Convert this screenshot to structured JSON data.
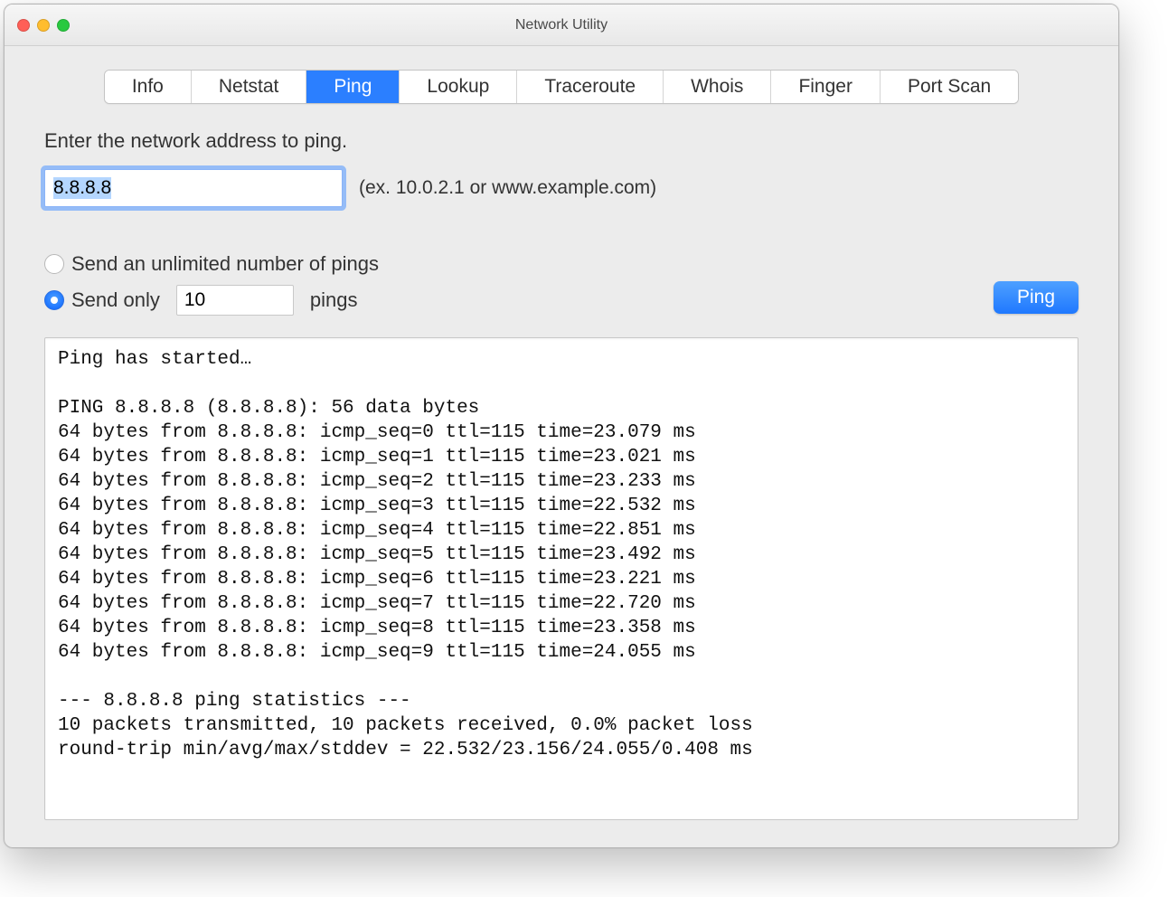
{
  "window": {
    "title": "Network Utility"
  },
  "tabs": [
    {
      "label": "Info",
      "active": false
    },
    {
      "label": "Netstat",
      "active": false
    },
    {
      "label": "Ping",
      "active": true
    },
    {
      "label": "Lookup",
      "active": false
    },
    {
      "label": "Traceroute",
      "active": false
    },
    {
      "label": "Whois",
      "active": false
    },
    {
      "label": "Finger",
      "active": false
    },
    {
      "label": "Port Scan",
      "active": false
    }
  ],
  "form": {
    "prompt": "Enter the network address to ping.",
    "address_value": "8.8.8.8",
    "example_hint": "(ex. 10.0.2.1 or www.example.com)",
    "radio_unlimited": "Send an unlimited number of pings",
    "radio_sendonly_pre": "Send only",
    "radio_sendonly_post": "pings",
    "count_value": "10",
    "selected_radio": "sendonly",
    "button_label": "Ping"
  },
  "output_text": "Ping has started…\n\nPING 8.8.8.8 (8.8.8.8): 56 data bytes\n64 bytes from 8.8.8.8: icmp_seq=0 ttl=115 time=23.079 ms\n64 bytes from 8.8.8.8: icmp_seq=1 ttl=115 time=23.021 ms\n64 bytes from 8.8.8.8: icmp_seq=2 ttl=115 time=23.233 ms\n64 bytes from 8.8.8.8: icmp_seq=3 ttl=115 time=22.532 ms\n64 bytes from 8.8.8.8: icmp_seq=4 ttl=115 time=22.851 ms\n64 bytes from 8.8.8.8: icmp_seq=5 ttl=115 time=23.492 ms\n64 bytes from 8.8.8.8: icmp_seq=6 ttl=115 time=23.221 ms\n64 bytes from 8.8.8.8: icmp_seq=7 ttl=115 time=22.720 ms\n64 bytes from 8.8.8.8: icmp_seq=8 ttl=115 time=23.358 ms\n64 bytes from 8.8.8.8: icmp_seq=9 ttl=115 time=24.055 ms\n\n--- 8.8.8.8 ping statistics ---\n10 packets transmitted, 10 packets received, 0.0% packet loss\nround-trip min/avg/max/stddev = 22.532/23.156/24.055/0.408 ms"
}
